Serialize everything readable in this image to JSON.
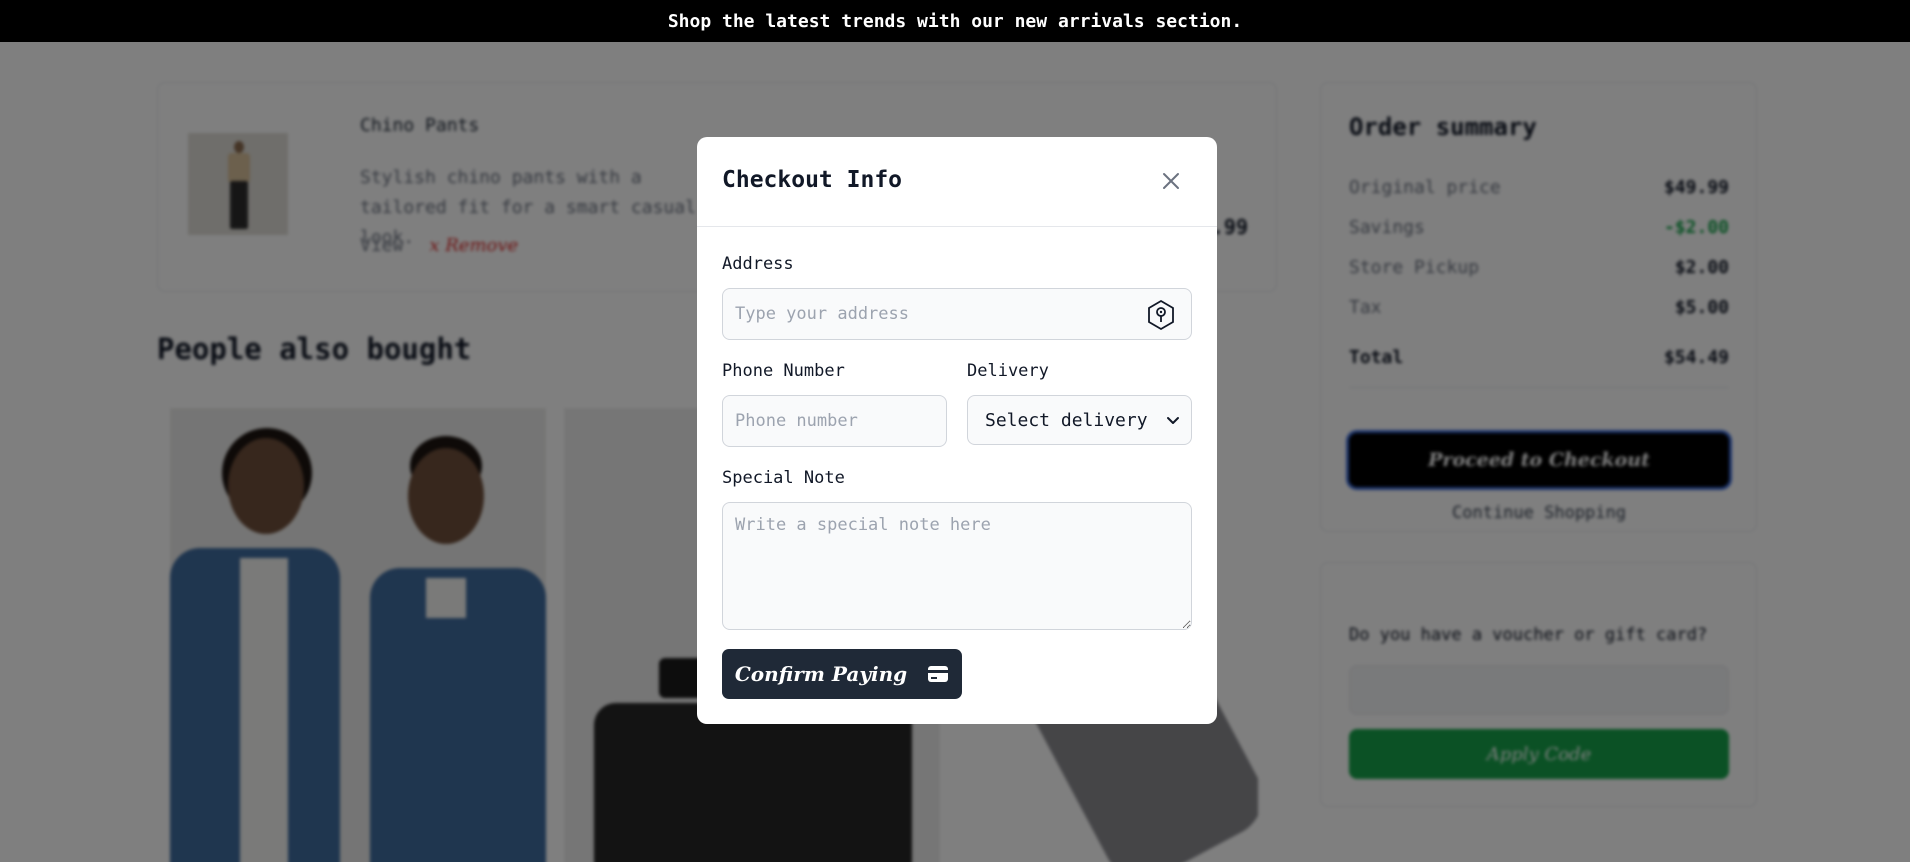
{
  "banner": {
    "text": "Shop the latest trends with our new arrivals section."
  },
  "cart": {
    "item_title": "Chino Pants",
    "item_description": "Stylish chino pants with a tailored fit for a smart casual look.",
    "view_label": "View",
    "remove_label": "x Remove"
  },
  "people_also_bought": {
    "title": "People also bought"
  },
  "order_summary": {
    "title": "Order summary",
    "rows": [
      {
        "label": "Original price",
        "value": "$49.99"
      },
      {
        "label": "Savings",
        "value": "-$2.00"
      },
      {
        "label": "Store Pickup",
        "value": "$2.00"
      },
      {
        "label": "Tax",
        "value": "$5.00"
      }
    ],
    "total_label": "Total",
    "total_value": "$54.49",
    "checkout_label": "Proceed to Checkout",
    "continue_label": "Continue Shopping"
  },
  "voucher": {
    "label": "Do you have a voucher or gift card?",
    "apply_label": "Apply Code"
  },
  "modal": {
    "title": "Checkout Info",
    "address_label": "Address",
    "address_placeholder": "Type your address",
    "phone_label": "Phone Number",
    "phone_placeholder": "Phone number",
    "delivery_label": "Delivery",
    "delivery_selected": "Select delivery option",
    "note_label": "Special Note",
    "note_placeholder": "Write a special note here",
    "confirm_label": "Confirm Paying"
  },
  "colors": {
    "banner_bg": "#000000",
    "modal_button": "#1f2937",
    "apply_button": "#16a34a",
    "savings": "#16a34a",
    "remove": "#dc2626"
  },
  "icons": {
    "close": "close-icon",
    "address": "map-pin-shield-icon",
    "delivery": "chevron-down-icon",
    "confirm": "credit-card-icon"
  }
}
